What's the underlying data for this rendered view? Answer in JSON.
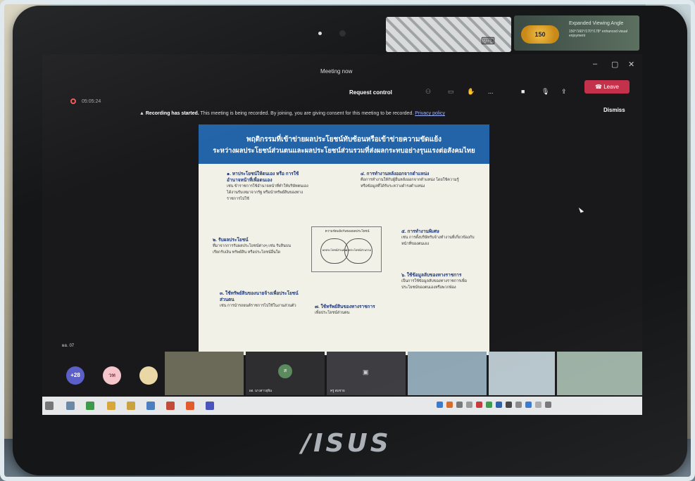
{
  "meeting": {
    "window_title": "Meeting now",
    "timer": "05:05:24",
    "request_control": "Request control",
    "leave_label": "Leave",
    "win_minimize": "–",
    "win_maximize": "▢",
    "win_close": "✕",
    "more_label": "...",
    "banner_strong": "Recording has started.",
    "banner_text": " This meeting is being recorded. By joining, you are giving consent for this meeting to be recorded.",
    "banner_link": "Privacy policy",
    "dismiss_label": "Dismiss"
  },
  "monitor": {
    "brand": "/ISUS",
    "sticker_badge": "150",
    "sticker_title": "Expanded Viewing Angle",
    "sticker_sub": "150°/160°/170°/178° enhanced visual enjoyment"
  },
  "slide": {
    "title_line1": "พฤติกรรมที่เข้าข่ายผลประโยชน์ทับซ้อนหรือเข้าข่ายความขัดแย้ง",
    "title_line2": "ระหว่างผลประโยชน์ส่วนตนและผลประโยชน์ส่วนรวมที่ส่งผลกระทบอย่างรุนแรงต่อสังคมไทย",
    "block1_head": "๑. หาประโยชน์ให้ตนเอง หรือ การใช้อำนาจหน้าที่เพื่อตนเอง",
    "block1_text": "เช่น ข้าราชการใช้อำนาจหน้าที่ทำให้บริษัทตนเองได้งานรับเหมาจากรัฐ หรือนำทรัพย์สินของทางราชการไปใช้",
    "block2_head": "๒. รับผลประโยชน์",
    "block2_text": "ที่มาจากการรับผลประโยชน์ต่างๆ เช่น รับสินบน เรียกรับเงิน ทรัพย์สิน หรือประโยชน์อื่นใด",
    "block3_head": "๓. ใช้ทรัพย์สินของนายจ้างเพื่อประโยชน์ส่วนตน",
    "block3_text": "เช่น การนำรถยนต์ราชการไปใช้ในงานส่วนตัว",
    "block4_head": "๔. การทำงานหลังออกจากตำแหน่ง",
    "block4_text": "คือการทำงานให้กับผู้อื่นหลังออกจากตำแหน่ง โดยใช้ความรู้หรือข้อมูลที่ได้รับระหว่างดำรงตำแหน่ง",
    "block5_head": "๕. การทำงานพิเศษ",
    "block5_text": "เช่น การตั้งบริษัทรับจ้างทำงานที่เกี่ยวข้องกับหน้าที่ของตนเอง",
    "block6_head": "๖. ใช้ข้อมูลลับของทางราชการ",
    "block6_text": "เป็นการใช้ข้อมูลลับของทางราชการเพื่อประโยชน์ของตนเองหรือพวกพ้อง",
    "block7_head": "๗. ใช้ทรัพย์สินของทางราชการ",
    "block7_text": "เพื่อประโยชน์ส่วนตน",
    "venn_title": "ความขัดแย้งกันของผลประโยชน์",
    "venn_left": "ผลประโยชน์ส่วนตน",
    "venn_right": "ผลประโยชน์ส่วนรวม"
  },
  "gallery": {
    "self_label": "ผอ. 07",
    "more_count": "+28",
    "initials_1": "วท",
    "tile_names": [
      "",
      "ผอ. นางสาวยุพิน",
      "ครู สมชาย",
      "",
      ""
    ],
    "avatar_initial": "ส",
    "tile_colors": [
      "#6b6a58",
      "#2e2e30",
      "#3e3e42",
      "#8fa7b5",
      "#b7c6cc",
      "#9cb0a4"
    ]
  },
  "colors": {
    "leave": "#c4314b",
    "slide_header": "#2364a9",
    "more_avatar": "#5b5fc7",
    "initials_avatar": "#f4c6cc"
  }
}
